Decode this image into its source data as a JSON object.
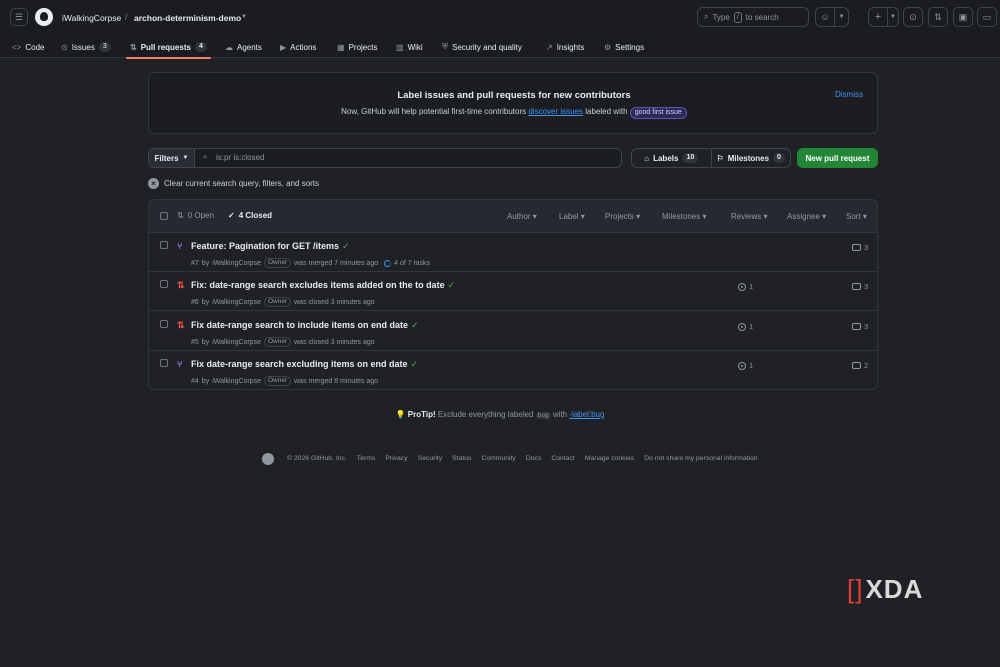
{
  "header": {
    "owner": "iWalkingCorpse",
    "separator": "/",
    "repo": "archon-determinism-demo",
    "search": {
      "prefix": "Type",
      "key": "/",
      "suffix": "to search"
    }
  },
  "tabs": [
    {
      "label": "Code"
    },
    {
      "label": "Issues",
      "count": "3"
    },
    {
      "label": "Pull requests",
      "count": "4"
    },
    {
      "label": "Agents"
    },
    {
      "label": "Actions"
    },
    {
      "label": "Projects"
    },
    {
      "label": "Wiki"
    },
    {
      "label": "Security and quality"
    },
    {
      "label": "Insights"
    },
    {
      "label": "Settings"
    }
  ],
  "banner": {
    "title": "Label issues and pull requests for new contributors",
    "text_before": "Now, GitHub will help potential first-time contributors",
    "link": "discover issues",
    "text_after": "labeled with",
    "badge": "good first issue",
    "dismiss": "Dismiss"
  },
  "filters": {
    "button": "Filters",
    "query": "is:pr is:closed",
    "labels_label": "Labels",
    "labels_count": "10",
    "milestones_label": "Milestones",
    "milestones_count": "0",
    "new_pr": "New pull request",
    "clear": "Clear current search query, filters, and sorts"
  },
  "list_header": {
    "open": "0 Open",
    "closed": "4 Closed",
    "filters": [
      "Author",
      "Label",
      "Projects",
      "Milestones",
      "Reviews",
      "Assignee",
      "Sort"
    ]
  },
  "prs": [
    {
      "title": "Feature: Pagination for GET /items",
      "number": "#7",
      "author": "iWalkingCorpse",
      "badge": "Owner",
      "action": "was merged 7 minutes ago",
      "tasks": "4 of 7 tasks",
      "linked": "",
      "comments": "3",
      "state": "merged"
    },
    {
      "title": "Fix: date-range search excludes items added on the to date",
      "number": "#6",
      "author": "iWalkingCorpse",
      "badge": "Owner",
      "action": "was closed 3 minutes ago",
      "tasks": "",
      "linked": "1",
      "comments": "3",
      "state": "closed"
    },
    {
      "title": "Fix date-range search to include items on end date",
      "number": "#5",
      "author": "iWalkingCorpse",
      "badge": "Owner",
      "action": "was closed 3 minutes ago",
      "tasks": "",
      "linked": "1",
      "comments": "3",
      "state": "closed"
    },
    {
      "title": "Fix date-range search excluding items on end date",
      "number": "#4",
      "author": "iWalkingCorpse",
      "badge": "Owner",
      "action": "was merged 8 minutes ago",
      "tasks": "",
      "linked": "1",
      "comments": "2",
      "state": "merged"
    }
  ],
  "protip": {
    "label": "ProTip!",
    "text": "Exclude everything labeled",
    "code": "bug",
    "with": "with",
    "link": "-label:bug"
  },
  "footer": [
    "© 2026 GitHub, Inc.",
    "Terms",
    "Privacy",
    "Security",
    "Status",
    "Community",
    "Docs",
    "Contact",
    "Manage cookies",
    "Do not share my personal information"
  ],
  "watermark": "XDA",
  "colors": {
    "accent": "#f78166",
    "link": "#4493f8",
    "primary_button": "#238636",
    "merged": "#ab7df8",
    "closed": "#f85149",
    "check": "#3fb950"
  }
}
